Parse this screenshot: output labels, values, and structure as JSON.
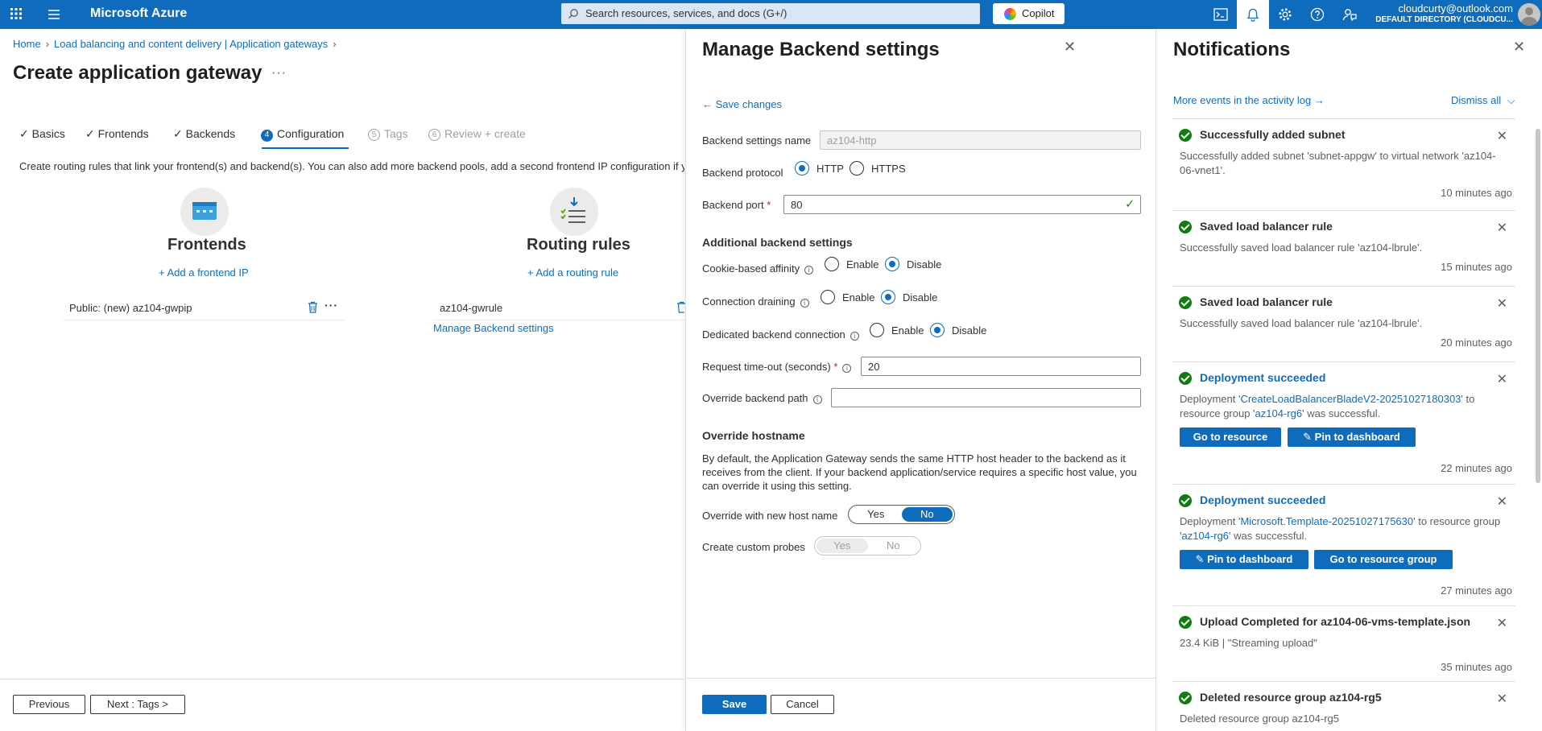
{
  "topbar": {
    "brand": "Microsoft Azure",
    "search_placeholder": "Search resources, services, and docs (G+/)",
    "copilot_label": "Copilot",
    "account_email": "cloudcurty@outlook.com",
    "account_directory": "DEFAULT DIRECTORY (CLOUDCU..."
  },
  "breadcrumb": [
    "Home",
    "Load balancing and content delivery | Application gateways"
  ],
  "page": {
    "title": "Create application gateway",
    "more": "···",
    "tabs": [
      {
        "label": "Basics",
        "state": "done"
      },
      {
        "label": "Frontends",
        "state": "done"
      },
      {
        "label": "Backends",
        "state": "done"
      },
      {
        "label": "Configuration",
        "state": "active",
        "num": "4"
      },
      {
        "label": "Tags",
        "state": "disabled",
        "num": "5"
      },
      {
        "label": "Review + create",
        "state": "disabled",
        "num": "6"
      }
    ],
    "description": "Create routing rules that link your frontend(s) and backend(s). You can also add more backend pools, add a second frontend IP configuration if you haven't already, or edit previous configurations.",
    "frontends": {
      "title": "Frontends",
      "add_link": "+ Add a frontend IP",
      "items": [
        "Public: (new) az104-gwpip"
      ]
    },
    "routing": {
      "title": "Routing rules",
      "add_link": "+ Add a routing rule",
      "items": [
        "az104-gwrule"
      ],
      "manage_link": "Manage Backend settings"
    },
    "buttons": {
      "previous": "Previous",
      "next": "Next : Tags >"
    }
  },
  "blade": {
    "title": "Manage Backend settings",
    "save_changes": "← Save changes",
    "name_label": "Backend settings name",
    "name_value": "az104-http",
    "protocol_label": "Backend protocol",
    "protocol_options": [
      "HTTP",
      "HTTPS"
    ],
    "protocol_selected": "HTTP",
    "port_label": "Backend port",
    "port_value": "80",
    "additional_title": "Additional backend settings",
    "cookie_label": "Cookie-based affinity",
    "draining_label": "Connection draining",
    "dedicated_label": "Dedicated backend connection",
    "enable": "Enable",
    "disable": "Disable",
    "timeout_label": "Request time-out (seconds)",
    "timeout_value": "20",
    "override_path_label": "Override backend path",
    "override_path_value": "",
    "hostname_title": "Override hostname",
    "hostname_para": "By default, the Application Gateway sends the same HTTP host header to the backend as it receives from the client. If your backend application/service requires a specific host value, you can override it using this setting.",
    "new_host_label": "Override with new host name",
    "probes_label": "Create custom probes",
    "yes": "Yes",
    "no": "No",
    "save": "Save",
    "cancel": "Cancel"
  },
  "notifications": {
    "title": "Notifications",
    "activity_link": "More events in the activity log →",
    "dismiss_all": "Dismiss all",
    "items": [
      {
        "title": "Successfully added subnet",
        "body": "Successfully added subnet 'subnet-appgw' to virtual network 'az104-06-vnet1'.",
        "time": "10 minutes ago"
      },
      {
        "title": "Saved load balancer rule",
        "body": "Successfully saved load balancer rule 'az104-lbrule'.",
        "time": "15 minutes ago"
      },
      {
        "title": "Saved load balancer rule",
        "body": "Successfully saved load balancer rule 'az104-lbrule'.",
        "time": "20 minutes ago"
      },
      {
        "title": "Deployment succeeded",
        "body_prefix": "Deployment '",
        "link1": "CreateLoadBalancerBladeV2-20251027180303",
        "body_mid": "' to resource group '",
        "link2": "az104-rg6",
        "body_suffix": "' was successful.",
        "btn1": "Go to resource",
        "btn2": "Pin to dashboard",
        "time": "22 minutes ago"
      },
      {
        "title": "Deployment succeeded",
        "body_prefix": "Deployment '",
        "link1": "Microsoft.Template-20251027175630",
        "body_mid": "' to resource group '",
        "link2": "az104-rg6",
        "body_suffix": "' was successful.",
        "btn1": "Pin to dashboard",
        "btn2": "Go to resource group",
        "time": "27 minutes ago"
      },
      {
        "title": "Upload Completed for az104-06-vms-template.json",
        "body": "23.4 KiB | \"Streaming upload\"",
        "time": "35 minutes ago"
      },
      {
        "title": "Deleted resource group az104-rg5",
        "body": "Deleted resource group az104-rg5"
      }
    ]
  },
  "colors": {
    "accent": "#0f6cbd",
    "success": "#107c10"
  }
}
